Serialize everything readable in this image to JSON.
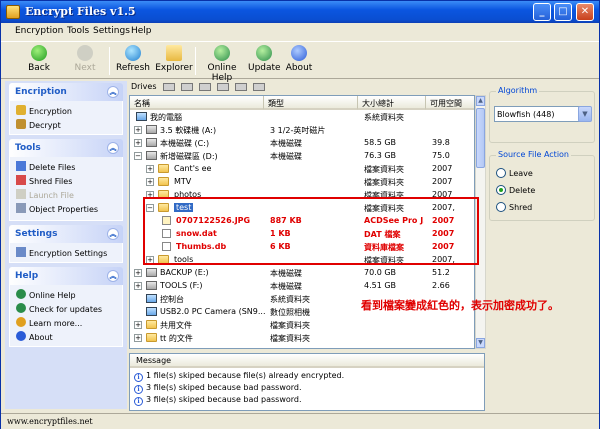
{
  "window": {
    "title": "Encrypt Files v1.5"
  },
  "menu": [
    "Encryption",
    "Tools",
    "Settings",
    "Help"
  ],
  "toolbar": {
    "back": "Back",
    "next": "Next",
    "refresh": "Refresh",
    "explorer": "Explorer",
    "online_help": "Online Help",
    "update": "Update",
    "about": "About"
  },
  "sidebar": {
    "encryption": {
      "title": "Encription",
      "items": [
        "Encryption",
        "Decrypt"
      ]
    },
    "tools": {
      "title": "Tools",
      "items": [
        "Delete Files",
        "Shred Files",
        "Launch File",
        "Object Properties"
      ]
    },
    "settings": {
      "title": "Settings",
      "items": [
        "Encryption Settings"
      ]
    },
    "help": {
      "title": "Help",
      "items": [
        "Online Help",
        "Check for updates",
        "Learn more...",
        "About"
      ]
    }
  },
  "drives_label": "Drives",
  "filelist": {
    "columns": [
      "名稱",
      "類型",
      "大小總計",
      "可用空間"
    ],
    "rows": [
      {
        "name": "我的電腦",
        "type": "",
        "size": "系統資料夾",
        "free": ""
      },
      {
        "name": "3.5 軟碟機 (A:)",
        "type": "3 1/2-英吋磁片",
        "size": "",
        "free": ""
      },
      {
        "name": "本機磁碟 (C:)",
        "type": "本機磁碟",
        "size": "58.5 GB",
        "free": "39.8"
      },
      {
        "name": "新增磁碟區 (D:)",
        "type": "本機磁碟",
        "size": "76.3 GB",
        "free": "75.0"
      },
      {
        "name": "Cant's ee",
        "type": "",
        "size": "檔案資料夾",
        "free": "2007"
      },
      {
        "name": "MTV",
        "type": "",
        "size": "檔案資料夾",
        "free": "2007"
      },
      {
        "name": "photos",
        "type": "",
        "size": "檔案資料夾",
        "free": "2007"
      },
      {
        "name": "test",
        "type": "",
        "size": "檔案資料夾",
        "free": "2007,"
      },
      {
        "name": "0707122526.JPG",
        "type": "887 KB",
        "size": "ACDSee Pro J...",
        "free": "2007"
      },
      {
        "name": "snow.dat",
        "type": "1 KB",
        "size": "DAT 檔案",
        "free": "2007"
      },
      {
        "name": "Thumbs.db",
        "type": "6 KB",
        "size": "資料庫檔案",
        "free": "2007"
      },
      {
        "name": "tools",
        "type": "",
        "size": "檔案資料夾",
        "free": "2007,"
      },
      {
        "name": "BACKUP (E:)",
        "type": "本機磁碟",
        "size": "70.0 GB",
        "free": "51.2"
      },
      {
        "name": "TOOLS (F:)",
        "type": "本機磁碟",
        "size": "4.51 GB",
        "free": "2.66"
      },
      {
        "name": "控制台",
        "type": "系統資料夾",
        "size": "",
        "free": ""
      },
      {
        "name": "USB2.0 PC Camera (SN9...",
        "type": "數位照相機",
        "size": "",
        "free": ""
      },
      {
        "name": "共用文件",
        "type": "檔案資料夾",
        "size": "",
        "free": ""
      },
      {
        "name": "tt 的文件",
        "type": "檔案資料夾",
        "size": "",
        "free": ""
      }
    ]
  },
  "annotation": "看到檔案變成紅色的，表示加密成功了。",
  "messages": {
    "header": "Message",
    "items": [
      "1 file(s) skiped because file(s) already encrypted.",
      "3 file(s) skiped because bad password.",
      "3 file(s) skiped because bad password."
    ]
  },
  "algorithm": {
    "legend": "Algorithm",
    "value": "Blowfish (448)"
  },
  "source_action": {
    "legend": "Source File Action",
    "options": [
      "Leave",
      "Delete",
      "Shred"
    ],
    "selected": "Delete"
  },
  "status": "www.encryptfiles.net",
  "colors": {
    "accent": "#0b56e0",
    "encrypted": "#e00000",
    "selection": "#316ac5"
  }
}
